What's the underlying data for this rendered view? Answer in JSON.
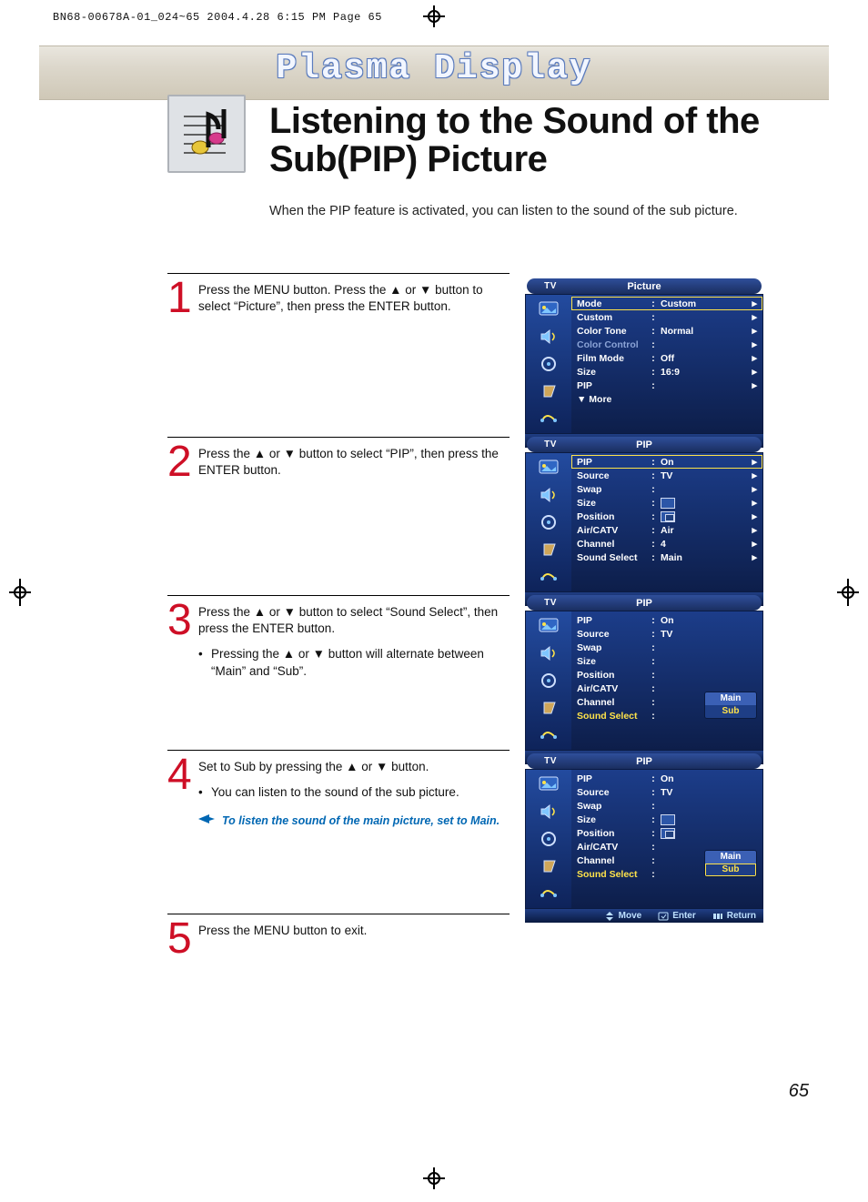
{
  "dateline": "BN68-00678A-01_024~65  2004.4.28  6:15 PM  Page 65",
  "banner_title": "Plasma Display",
  "headline": "Listening to the Sound of the Sub(PIP) Picture",
  "intro": "When the PIP feature is activated, you can listen to the sound of the sub picture.",
  "page_number": "65",
  "steps": {
    "s1": {
      "num": "1",
      "text": "Press the MENU button. Press the ▲ or ▼ button to select “Picture”, then press the ENTER button."
    },
    "s2": {
      "num": "2",
      "text": "Press the ▲ or ▼ button to select “PIP”, then press the ENTER button."
    },
    "s3": {
      "num": "3",
      "text": "Press the ▲ or ▼ button to select “Sound Select”, then press the ENTER button.",
      "bullet": "Pressing the ▲ or ▼ button will alternate between “Main” and “Sub”."
    },
    "s4": {
      "num": "4",
      "text": "Set to Sub by pressing the ▲ or ▼ button.",
      "bullet": "You can listen to the sound of the sub picture.",
      "tip": "To listen the sound of the main picture, set to Main."
    },
    "s5": {
      "num": "5",
      "text": "Press the MENU button to exit."
    }
  },
  "osd_common": {
    "tv": "TV",
    "foot_move": "Move",
    "foot_enter": "Enter",
    "foot_return": "Return"
  },
  "osd1": {
    "title": "Picture",
    "rows": [
      {
        "lbl": "Mode",
        "val": "Custom",
        "arr": "†",
        "sel": true
      },
      {
        "lbl": "Custom",
        "val": "",
        "arr": "†"
      },
      {
        "lbl": "Color Tone",
        "val": "Normal",
        "arr": "†"
      },
      {
        "lbl": "Color Control",
        "val": "",
        "arr": "†",
        "dim": true
      },
      {
        "lbl": "Film Mode",
        "val": "Off",
        "arr": "†"
      },
      {
        "lbl": "Size",
        "val": "16:9",
        "arr": "†"
      },
      {
        "lbl": "PIP",
        "val": "",
        "arr": "†"
      },
      {
        "lbl": "▼ More",
        "val": "",
        "arr": ""
      }
    ]
  },
  "osd2": {
    "title": "PIP",
    "rows": [
      {
        "lbl": "PIP",
        "val": "On",
        "arr": "†",
        "sel": true
      },
      {
        "lbl": "Source",
        "val": "TV",
        "arr": "†"
      },
      {
        "lbl": "Swap",
        "val": "",
        "arr": "†"
      },
      {
        "lbl": "Size",
        "val": "",
        "arr": "†",
        "pic": "plain"
      },
      {
        "lbl": "Position",
        "val": "",
        "arr": "†",
        "pic": "tr"
      },
      {
        "lbl": "Air/CATV",
        "val": "Air",
        "arr": "†"
      },
      {
        "lbl": "Channel",
        "val": "4",
        "arr": "†"
      },
      {
        "lbl": "Sound Select",
        "val": "Main",
        "arr": "†"
      }
    ]
  },
  "osd3": {
    "title": "PIP",
    "pop": {
      "a": "Main",
      "b": "Sub",
      "sel": false
    },
    "rows": [
      {
        "lbl": "PIP",
        "val": "On",
        "arr": ""
      },
      {
        "lbl": "Source",
        "val": "TV",
        "arr": ""
      },
      {
        "lbl": "Swap",
        "val": "",
        "arr": ""
      },
      {
        "lbl": "Size",
        "val": "",
        "arr": ""
      },
      {
        "lbl": "Position",
        "val": "",
        "arr": ""
      },
      {
        "lbl": "Air/CATV",
        "val": "",
        "arr": ""
      },
      {
        "lbl": "Channel",
        "val": "",
        "arr": ""
      },
      {
        "lbl": "Sound Select",
        "val": "",
        "arr": "",
        "hi": true
      }
    ]
  },
  "osd4": {
    "title": "PIP",
    "pop": {
      "a": "Main",
      "b": "Sub",
      "sel": true
    },
    "rows": [
      {
        "lbl": "PIP",
        "val": "On",
        "arr": ""
      },
      {
        "lbl": "Source",
        "val": "TV",
        "arr": ""
      },
      {
        "lbl": "Swap",
        "val": "",
        "arr": ""
      },
      {
        "lbl": "Size",
        "val": "",
        "arr": "",
        "pic": "plain"
      },
      {
        "lbl": "Position",
        "val": "",
        "arr": "",
        "pic": "tr"
      },
      {
        "lbl": "Air/CATV",
        "val": "",
        "arr": ""
      },
      {
        "lbl": "Channel",
        "val": "",
        "arr": ""
      },
      {
        "lbl": "Sound Select",
        "val": "",
        "arr": "",
        "hi": true
      }
    ]
  }
}
